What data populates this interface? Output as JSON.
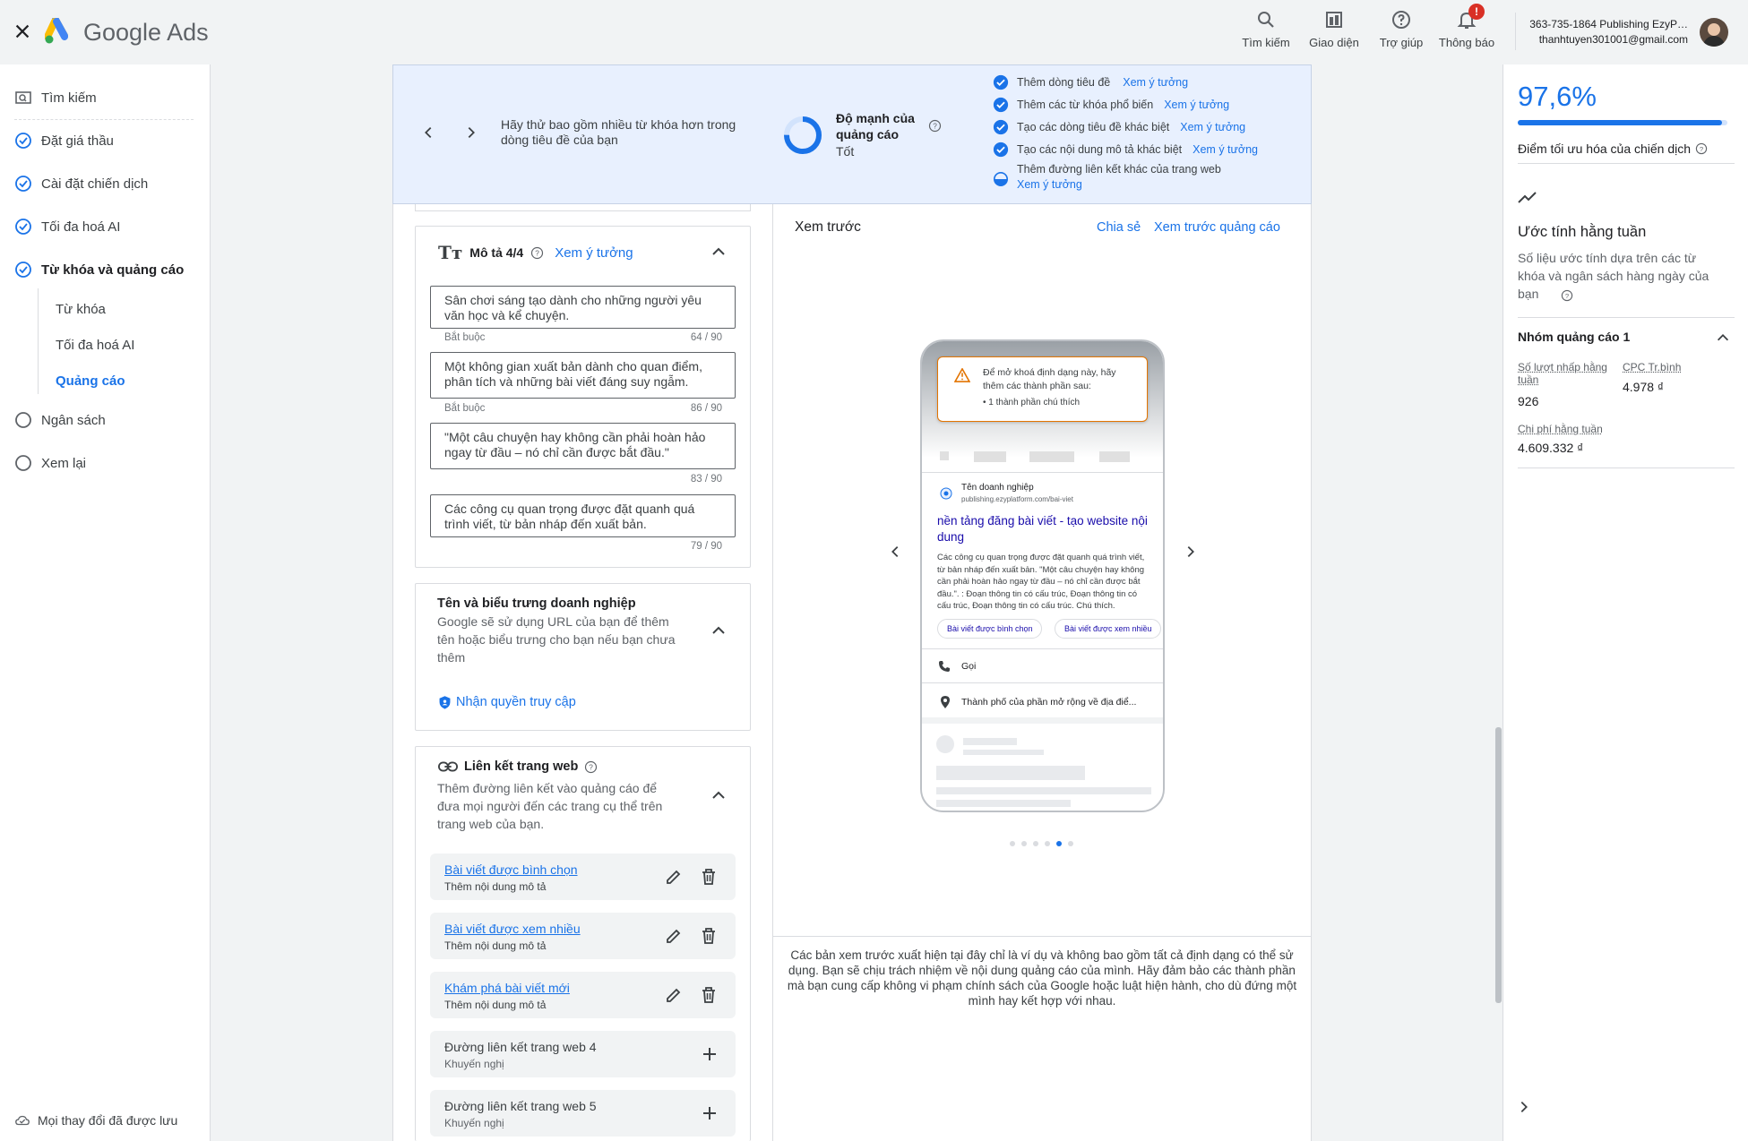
{
  "header": {
    "brand": "Google Ads",
    "buttons": [
      {
        "label": "Tìm kiếm",
        "icon": "search-icon"
      },
      {
        "label": "Giao diện",
        "icon": "appearance-icon"
      },
      {
        "label": "Trợ giúp",
        "icon": "help-icon"
      },
      {
        "label": "Thông báo",
        "icon": "bell-icon",
        "badge": "!"
      }
    ],
    "account_line1": "363-735-1864 Publishing EzyP…",
    "account_line2": "thanhtuyen301001@gmail.com"
  },
  "leftnav": {
    "search": "Tìm kiếm",
    "items": [
      {
        "label": "Đặt giá thầu",
        "state": "done"
      },
      {
        "label": "Cài đặt chiến dịch",
        "state": "done"
      },
      {
        "label": "Tối đa hoá AI",
        "state": "done"
      },
      {
        "label": "Từ khóa và quảng cáo",
        "state": "active"
      },
      {
        "label": "Ngân sách",
        "state": "todo"
      },
      {
        "label": "Xem lại",
        "state": "todo"
      }
    ],
    "subitems": [
      "Từ khóa",
      "Tối đa hoá AI",
      "Quảng cáo"
    ],
    "saved": "Mọi thay đổi đã được lưu"
  },
  "banner": {
    "tip": "Hãy thử bao gồm nhiều từ khóa hơn trong dòng tiêu đề của bạn",
    "strength_label": "Độ mạnh của quảng cáo",
    "strength_value": "Tốt",
    "idea_link": "Xem ý tưởng",
    "checklist": [
      "Thêm dòng tiêu đề",
      "Thêm các từ khóa phổ biến",
      "Tạo các dòng tiêu đề khác biệt",
      "Tạo các nội dung mô tả khác biệt",
      "Thêm đường liên kết khác của trang web"
    ]
  },
  "descriptions": {
    "title": "Mô tả 4/4",
    "idea_link": "Xem ý tưởng",
    "required": "Bắt buộc",
    "items": [
      {
        "text": "Sân chơi sáng tạo dành cho những người yêu văn học và kể chuyện.",
        "count": "64 / 90"
      },
      {
        "text": "Một không gian xuất bản dành cho quan điểm, phân tích và những bài viết đáng suy ngẫm.",
        "count": "86 / 90"
      },
      {
        "text": "\"Một câu chuyện hay không cần phải hoàn hảo ngay từ đầu – nó chỉ cần được bắt đầu.\"",
        "count": "83 / 90"
      },
      {
        "text": "Các công cụ quan trọng được đặt quanh quá trình viết, từ bản nháp đến xuất bản.",
        "count": "79 / 90"
      }
    ]
  },
  "business": {
    "title": "Tên và biểu trưng doanh nghiệp",
    "desc": "Google sẽ sử dụng URL của bạn để thêm tên hoặc biểu trưng cho bạn nếu bạn chưa thêm",
    "access": "Nhận quyền truy cập"
  },
  "sitelinks": {
    "title": "Liên kết trang web",
    "desc": "Thêm đường liên kết vào quảng cáo để đưa mọi người đến các trang cụ thể trên trang web của bạn.",
    "items": [
      {
        "title": "Bài viết được bình chọn",
        "sub": "Thêm nội dung mô tả"
      },
      {
        "title": "Bài viết được xem nhiều",
        "sub": "Thêm nội dung mô tả"
      },
      {
        "title": "Khám phá bài viết mới",
        "sub": "Thêm nội dung mô tả"
      }
    ],
    "empty": [
      {
        "title": "Đường liên kết trang web 4",
        "sub": "Khuyến nghị"
      },
      {
        "title": "Đường liên kết trang web 5",
        "sub": "Khuyến nghị"
      }
    ]
  },
  "preview": {
    "title": "Xem trước",
    "share": "Chia sẻ",
    "preview_ad": "Xem trước quảng cáo",
    "warning": "Để mở khoá định dạng này, hãy thêm các thành phần sau:",
    "warning_item": "1 thành phần chú thích",
    "biz_name": "Tên doanh nghiệp",
    "biz_url": "publishing.ezyplatform.com/bai-viet",
    "ad_headline": "nền tảng đăng bài viết - tạo website nội dung",
    "ad_desc": "Các công cụ quan trọng được đặt quanh quá trình viết, từ bản nháp đến xuất bản. \"Một câu chuyện hay không cần phải hoàn hảo ngay từ đầu – nó chỉ cần được bắt đầu.\". : Đoạn thông tin có cấu trúc, Đoạn thông tin có cấu trúc, Đoạn thông tin có cấu trúc. Chú thích.",
    "chips": [
      "Bài viết được bình chọn",
      "Bài viết được xem nhiều"
    ],
    "call": "Gọi",
    "location": "Thành phố của phần mở rộng về địa điể...",
    "disclaimer": "Các bản xem trước xuất hiện tại đây chỉ là ví dụ và không bao gồm tất cả định dạng có thể sử dụng. Bạn sẽ chịu trách nhiệm về nội dung quảng cáo của mình. Hãy đảm bảo các thành phần mà bạn cung cấp không vi phạm chính sách của Google hoặc luật hiện hành, cho dù đứng một mình hay kết hợp với nhau.",
    "dots_total": 6,
    "dots_active": 5
  },
  "right": {
    "score": "97,6%",
    "score_fraction": 0.976,
    "score_label": "Điểm tối ưu hóa của chiến dịch",
    "weekly_title": "Ước tính hằng tuần",
    "weekly_desc": "Số liệu ước tính dựa trên các từ khóa và ngân sách hàng ngày của bạn",
    "group_title": "Nhóm quảng cáo 1",
    "clicks_label": "Số lượt nhấp hằng tuần",
    "clicks_value": "926",
    "cpc_label": "CPC Tr.bình",
    "cpc_value": "4.978 ₫",
    "cost_label": "Chi phí hằng tuần",
    "cost_value": "4.609.332 ₫"
  },
  "colors": {
    "accent": "#1a73e8",
    "warning": "#e37400",
    "badge": "#d93025"
  }
}
